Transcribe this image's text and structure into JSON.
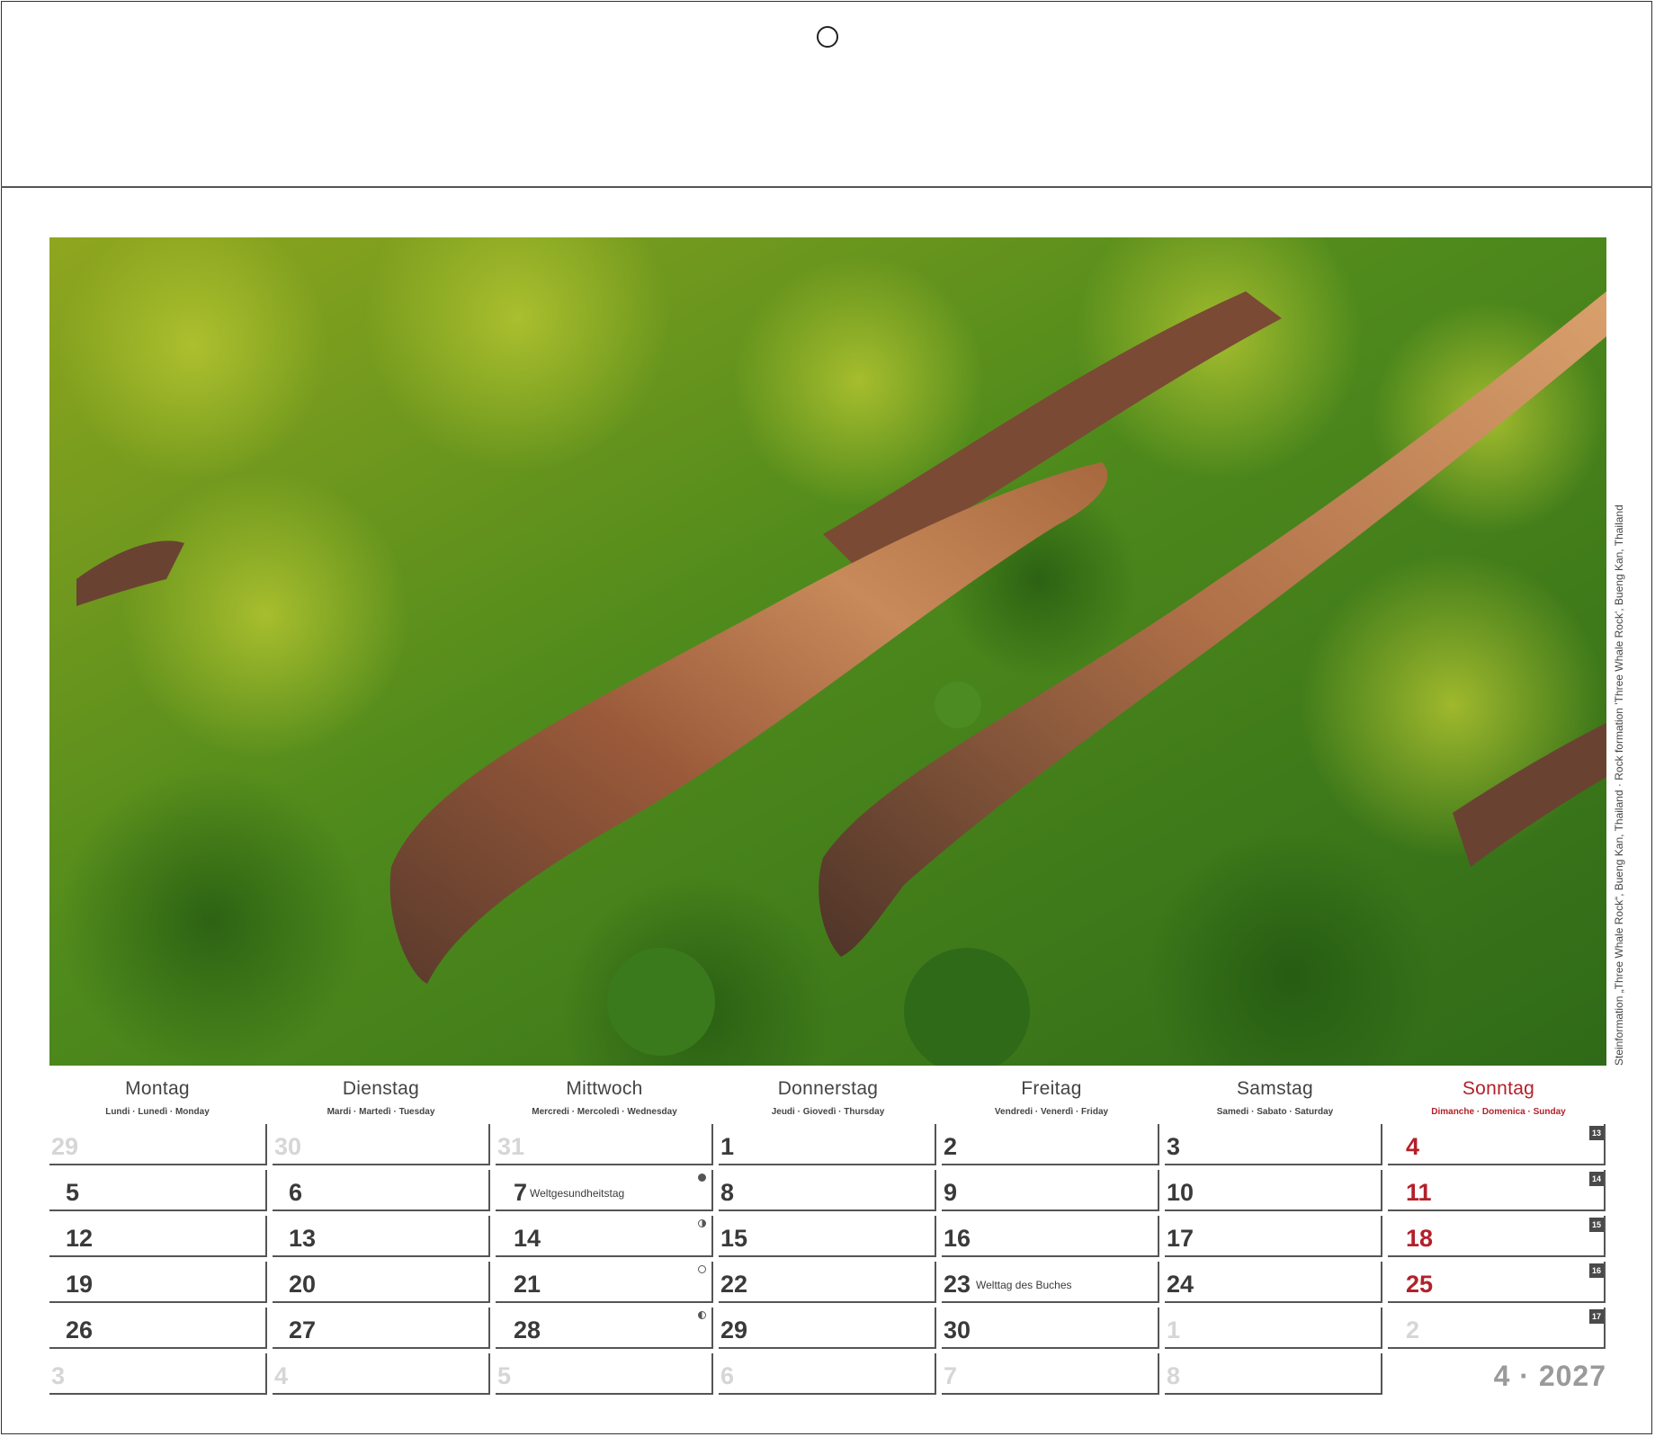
{
  "month_label": "4 · 2027",
  "photo": {
    "credit": "Steinformation „Three Whale Rock“, Bueng Kan, Thailand · Rock formation 'Three Whale Rock', Bueng Kan, Thailand"
  },
  "weekdays": [
    {
      "main": "Montag",
      "sub": "Lundi · Lunedì · Monday"
    },
    {
      "main": "Dienstag",
      "sub": "Mardi · Martedì · Tuesday"
    },
    {
      "main": "Mittwoch",
      "sub": "Mercredi · Mercoledì · Wednesday"
    },
    {
      "main": "Donnerstag",
      "sub": "Jeudi · Giovedì · Thursday"
    },
    {
      "main": "Freitag",
      "sub": "Vendredi · Venerdì · Friday"
    },
    {
      "main": "Samstag",
      "sub": "Samedi · Sabato · Saturday"
    },
    {
      "main": "Sonntag",
      "sub": "Dimanche · Domenica · Sunday"
    }
  ],
  "weeks": [
    {
      "week_no": "13",
      "days": [
        {
          "d": "29",
          "other": true
        },
        {
          "d": "30",
          "other": true
        },
        {
          "d": "31",
          "other": true
        },
        {
          "d": "1"
        },
        {
          "d": "2"
        },
        {
          "d": "3"
        },
        {
          "d": "4"
        }
      ]
    },
    {
      "week_no": "14",
      "days": [
        {
          "d": "5"
        },
        {
          "d": "6"
        },
        {
          "d": "7",
          "note": "Weltgesundheitstag",
          "moon": "new"
        },
        {
          "d": "8"
        },
        {
          "d": "9"
        },
        {
          "d": "10"
        },
        {
          "d": "11"
        }
      ]
    },
    {
      "week_no": "15",
      "days": [
        {
          "d": "12"
        },
        {
          "d": "13"
        },
        {
          "d": "14",
          "moon": "first"
        },
        {
          "d": "15"
        },
        {
          "d": "16"
        },
        {
          "d": "17"
        },
        {
          "d": "18"
        }
      ]
    },
    {
      "week_no": "16",
      "days": [
        {
          "d": "19"
        },
        {
          "d": "20"
        },
        {
          "d": "21",
          "moon": "full"
        },
        {
          "d": "22"
        },
        {
          "d": "23",
          "note": "Welttag des Buches"
        },
        {
          "d": "24"
        },
        {
          "d": "25"
        }
      ]
    },
    {
      "week_no": "17",
      "days": [
        {
          "d": "26"
        },
        {
          "d": "27"
        },
        {
          "d": "28",
          "moon": "last"
        },
        {
          "d": "29"
        },
        {
          "d": "30"
        },
        {
          "d": "1",
          "other": true
        },
        {
          "d": "2",
          "other": true
        }
      ]
    },
    {
      "week_no": "",
      "days": [
        {
          "d": "3",
          "other": true
        },
        {
          "d": "4",
          "other": true
        },
        {
          "d": "5",
          "other": true
        },
        {
          "d": "6",
          "other": true
        },
        {
          "d": "7",
          "other": true
        },
        {
          "d": "8",
          "other": true
        },
        {
          "d": "",
          "other": true
        }
      ]
    }
  ]
}
